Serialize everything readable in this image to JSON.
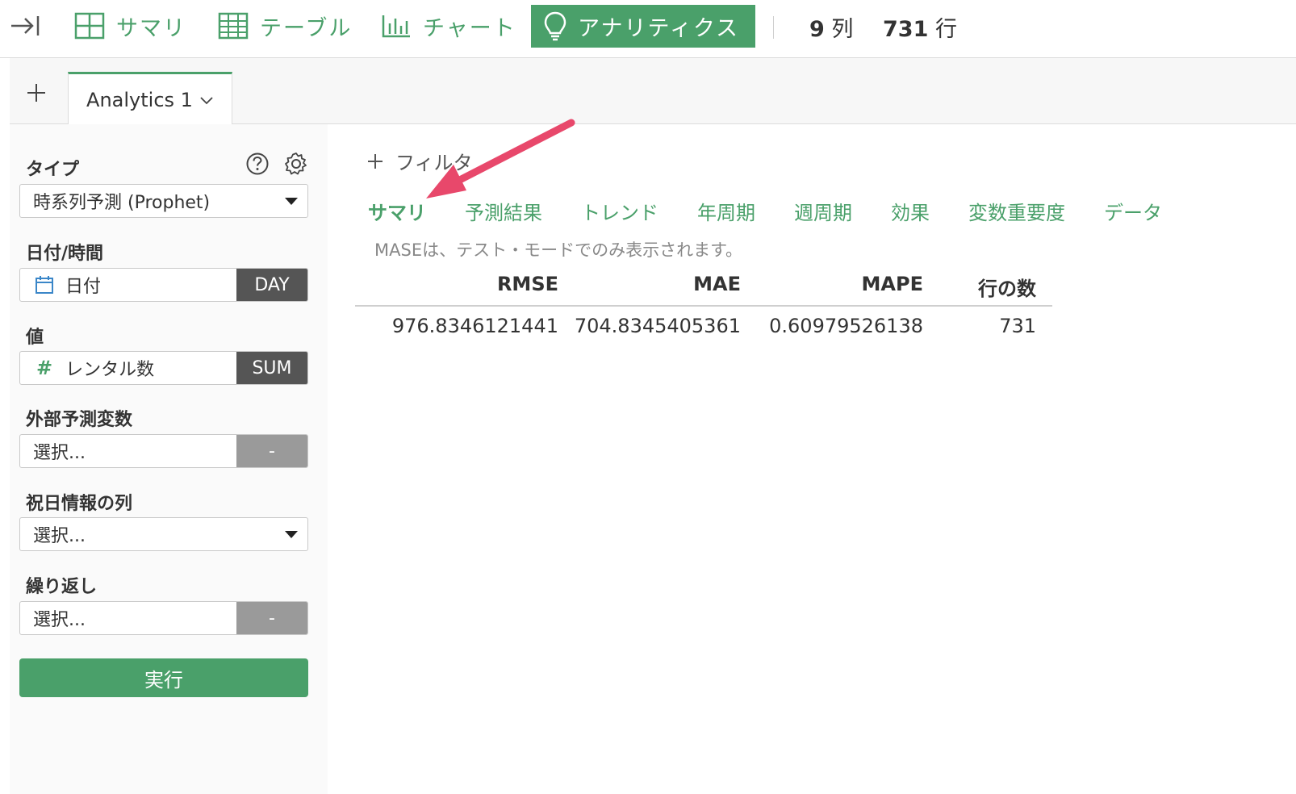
{
  "toolbar": {
    "collapse_icon": "arrow-to-right-icon",
    "items": [
      {
        "label": "サマリ",
        "icon": "grid-icon"
      },
      {
        "label": "テーブル",
        "icon": "table-icon"
      },
      {
        "label": "チャート",
        "icon": "bar-chart-icon"
      },
      {
        "label": "アナリティクス",
        "icon": "lightbulb-icon",
        "active": true
      }
    ],
    "columns_count": "9",
    "columns_unit": "列",
    "rows_count": "731",
    "rows_unit": "行"
  },
  "tabs": {
    "add_icon": "plus-icon",
    "items": [
      {
        "label": "Analytics 1",
        "icon": "chevron-down-icon"
      }
    ]
  },
  "sidebar": {
    "type": {
      "label": "タイプ",
      "value": "時系列予測 (Prophet)"
    },
    "date": {
      "label": "日付/時間",
      "value": "日付",
      "tag": "DAY"
    },
    "value": {
      "label": "値",
      "symbol": "#",
      "value": "レンタル数",
      "tag": "SUM"
    },
    "external": {
      "label": "外部予測変数",
      "value": "選択...",
      "tag": "-"
    },
    "holiday": {
      "label": "祝日情報の列",
      "value": "選択..."
    },
    "repeat": {
      "label": "繰り返し",
      "value": "選択...",
      "tag": "-"
    },
    "run_label": "実行"
  },
  "main": {
    "filter_label": "フィルタ",
    "subtabs": [
      {
        "label": "サマリ",
        "active": true
      },
      {
        "label": "予測結果"
      },
      {
        "label": "トレンド"
      },
      {
        "label": "年周期"
      },
      {
        "label": "週周期"
      },
      {
        "label": "効果"
      },
      {
        "label": "変数重要度"
      },
      {
        "label": "データ"
      }
    ],
    "note": "MASEは、テスト・モードでのみ表示されます。",
    "table": {
      "headers": [
        "RMSE",
        "MAE",
        "MAPE",
        "行の数"
      ],
      "row": [
        "976.8346121441",
        "704.8345405361",
        "0.60979526138",
        "731"
      ]
    }
  },
  "colors": {
    "accent": "#4aa06a",
    "annotation": "#e8486b"
  }
}
